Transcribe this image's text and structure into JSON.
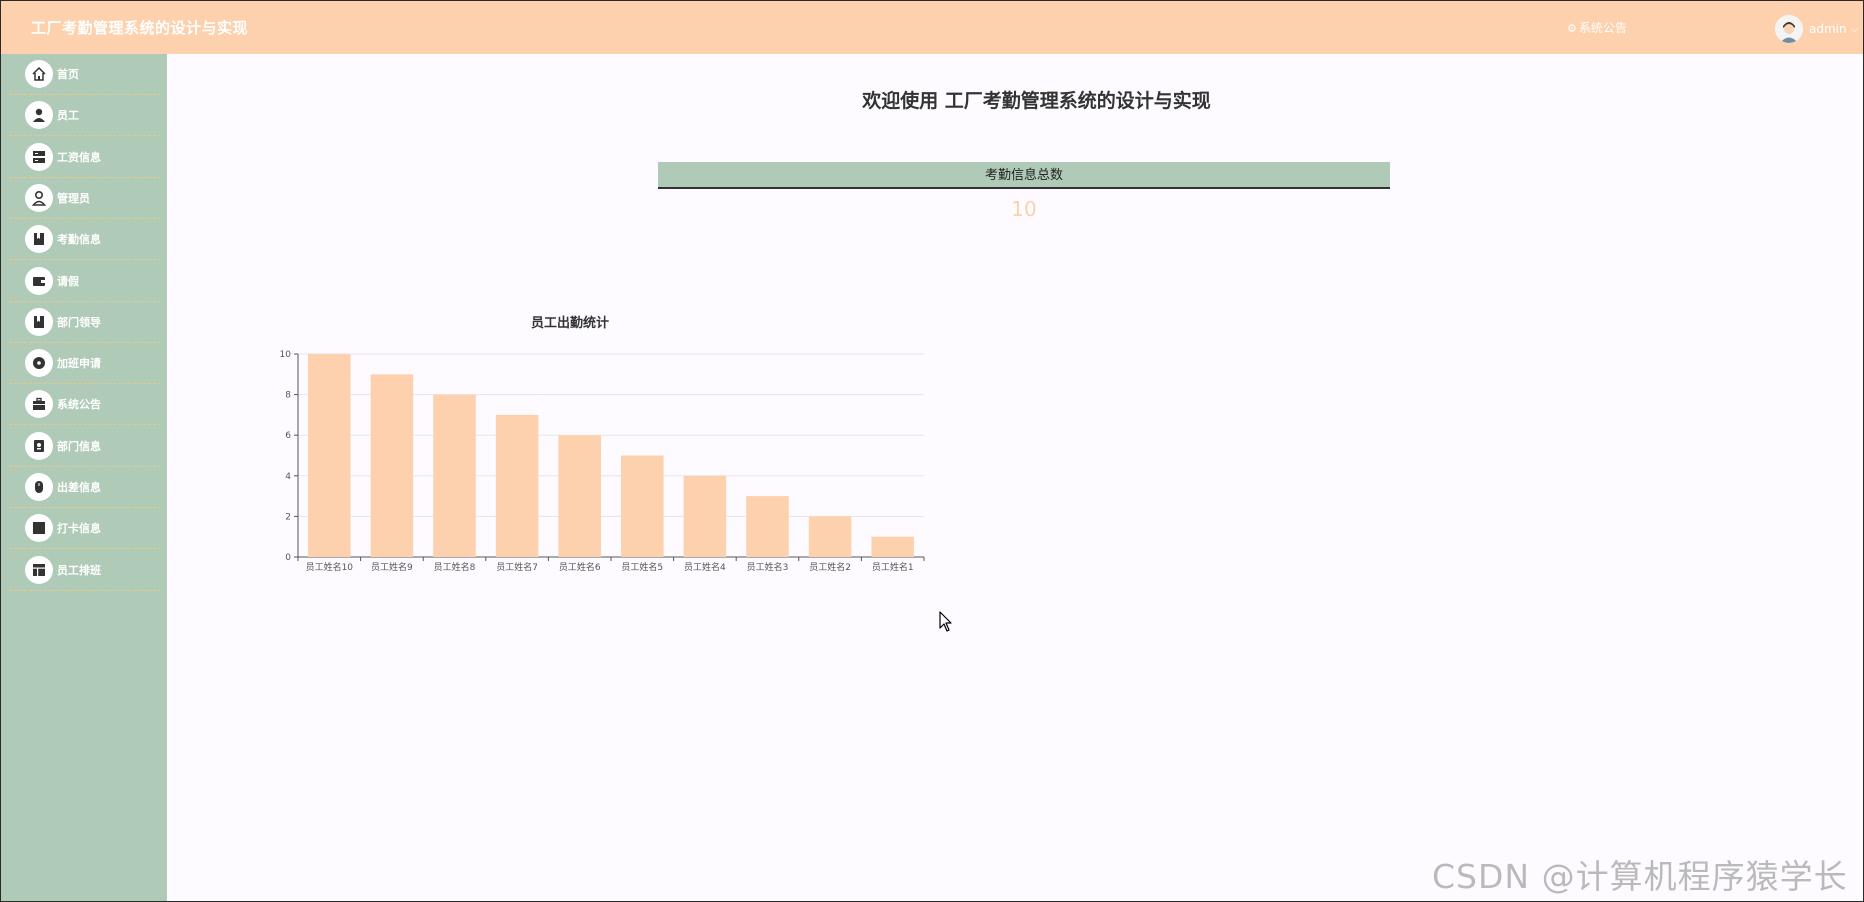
{
  "app": {
    "title": "工厂考勤管理系统的设计与实现",
    "notice_link": "系统公告",
    "username": "admin"
  },
  "sidebar": {
    "items": [
      {
        "label": "首页",
        "icon": "home-icon"
      },
      {
        "label": "员工",
        "icon": "user-icon"
      },
      {
        "label": "工资信息",
        "icon": "server-icon"
      },
      {
        "label": "管理员",
        "icon": "admin-icon"
      },
      {
        "label": "考勤信息",
        "icon": "bookmark-icon"
      },
      {
        "label": "请假",
        "icon": "wallet-icon"
      },
      {
        "label": "部门领导",
        "icon": "bookmark-icon"
      },
      {
        "label": "加班申请",
        "icon": "disc-icon"
      },
      {
        "label": "系统公告",
        "icon": "briefcase-icon"
      },
      {
        "label": "部门信息",
        "icon": "badge-icon"
      },
      {
        "label": "出差信息",
        "icon": "mouse-icon"
      },
      {
        "label": "打卡信息",
        "icon": "square-icon"
      },
      {
        "label": "员工排班",
        "icon": "layout-icon"
      }
    ]
  },
  "main": {
    "welcome": "欢迎使用 工厂考勤管理系统的设计与实现",
    "stat": {
      "label": "考勤信息总数",
      "value": "10"
    }
  },
  "colors": {
    "header_bg": "#fdd1ad",
    "sidebar_bg": "#afcbb8",
    "bar_color": "#fdd1ad",
    "stat_value": "#fdd1ad"
  },
  "chart_data": {
    "type": "bar",
    "title": "员工出勤统计",
    "categories": [
      "员工姓名10",
      "员工姓名9",
      "员工姓名8",
      "员工姓名7",
      "员工姓名6",
      "员工姓名5",
      "员工姓名4",
      "员工姓名3",
      "员工姓名2",
      "员工姓名1"
    ],
    "values": [
      10,
      9,
      8,
      7,
      6,
      5,
      4,
      3,
      2,
      1
    ],
    "xlabel": "",
    "ylabel": "",
    "ylim": [
      0,
      10
    ],
    "yticks": [
      0,
      2,
      4,
      6,
      8,
      10
    ],
    "grid": true,
    "legend": "none"
  },
  "watermark": "CSDN @计算机程序猿学长"
}
